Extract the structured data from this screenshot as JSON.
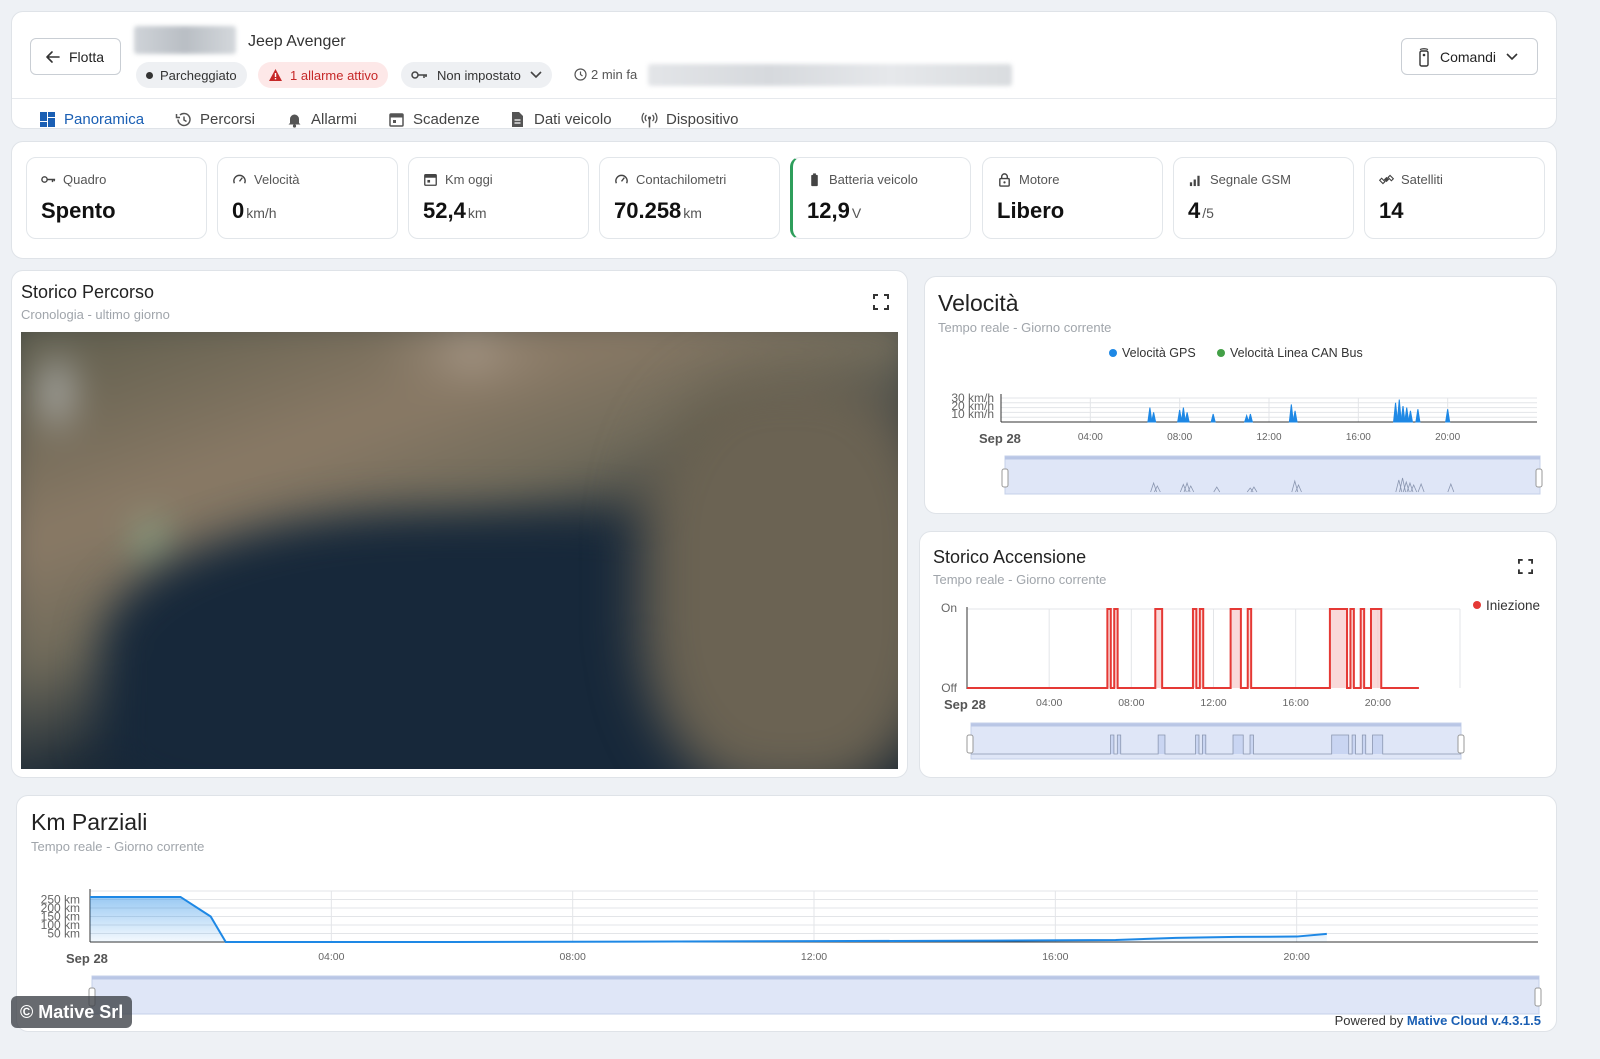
{
  "header": {
    "back_label": "Flotta",
    "vehicle_name": "Jeep Avenger",
    "status_parked": "Parcheggiato",
    "alarm_badge": "1 allarme attivo",
    "key_select": "Non impostato",
    "last_update": "2 min fa",
    "commands_label": "Comandi"
  },
  "tabs": [
    {
      "label": "Panoramica",
      "icon": "dashboard-icon",
      "active": true
    },
    {
      "label": "Percorsi",
      "icon": "history-icon"
    },
    {
      "label": "Allarmi",
      "icon": "bell-icon"
    },
    {
      "label": "Scadenze",
      "icon": "calendar-icon"
    },
    {
      "label": "Dati veicolo",
      "icon": "document-icon"
    },
    {
      "label": "Dispositivo",
      "icon": "antenna-icon"
    }
  ],
  "stats": [
    {
      "label": "Quadro",
      "value": "Spento",
      "unit": "",
      "icon": "key-icon"
    },
    {
      "label": "Velocità",
      "value": "0",
      "unit": "km/h",
      "icon": "speedometer-icon"
    },
    {
      "label": "Km oggi",
      "value": "52,4",
      "unit": "km",
      "icon": "calendar-icon"
    },
    {
      "label": "Contachilometri",
      "value": "70.258",
      "unit": "km",
      "icon": "odometer-icon"
    },
    {
      "label": "Batteria veicolo",
      "value": "12,9",
      "unit": "V",
      "icon": "battery-icon"
    },
    {
      "label": "Motore",
      "value": "Libero",
      "unit": "",
      "icon": "lock-icon"
    },
    {
      "label": "Segnale GSM",
      "value": "4",
      "unit": "/5",
      "icon": "signal-icon"
    },
    {
      "label": "Satelliti",
      "value": "14",
      "unit": "",
      "icon": "satellite-icon"
    }
  ],
  "route_panel": {
    "title": "Storico Percorso",
    "subtitle": "Cronologia - ultimo giorno"
  },
  "speed_panel": {
    "title": "Velocità",
    "subtitle": "Tempo reale - Giorno corrente"
  },
  "ignition_panel": {
    "title": "Storico Accensione",
    "subtitle": "Tempo reale - Giorno corrente"
  },
  "km_panel": {
    "title": "Km Parziali",
    "subtitle": "Tempo reale - Giorno corrente"
  },
  "footer": {
    "copyright": "© Mative Srl",
    "powered_prefix": "Powered by",
    "powered_brand": "Mative Cloud v.4.3.1.5"
  },
  "colors": {
    "accent": "#1a73e8",
    "gps": "#1e88e5",
    "can": "#43a047",
    "ignition": "#e53935",
    "alarm_bg": "#fde8e8",
    "alarm_text": "#c62828"
  },
  "chart_data": [
    {
      "type": "area",
      "title": "Velocità",
      "x_start_label": "Sep 28",
      "x_tick_labels": [
        "04:00",
        "08:00",
        "12:00",
        "16:00",
        "20:00"
      ],
      "y_tick_labels": [
        "10 km/h",
        "20 km/h",
        "30 km/h"
      ],
      "series": [
        {
          "name": "Velocità GPS",
          "color": "#1e88e5",
          "x": [
            "06:40",
            "06:50",
            "08:00",
            "08:10",
            "08:20",
            "09:30",
            "11:00",
            "11:10",
            "13:00",
            "13:10",
            "17:40",
            "17:50",
            "18:00",
            "18:10",
            "18:20",
            "18:40",
            "20:00"
          ],
          "y": [
            18,
            12,
            15,
            18,
            12,
            10,
            8,
            10,
            22,
            14,
            24,
            28,
            20,
            18,
            14,
            16,
            16
          ]
        },
        {
          "name": "Velocità Linea CAN Bus",
          "color": "#43a047",
          "x": [],
          "y": []
        }
      ],
      "legend": "top"
    },
    {
      "type": "line",
      "title": "Storico Accensione",
      "x_start_label": "Sep 28",
      "x_tick_labels": [
        "04:00",
        "08:00",
        "12:00",
        "16:00",
        "20:00"
      ],
      "y_categories": [
        "Off",
        "On"
      ],
      "series": [
        {
          "name": "Iniezione",
          "color": "#e53935",
          "intervals_on": [
            [
              "06:50",
              "07:00"
            ],
            [
              "07:10",
              "07:20"
            ],
            [
              "09:10",
              "09:30"
            ],
            [
              "11:00",
              "11:10"
            ],
            [
              "11:20",
              "11:30"
            ],
            [
              "12:50",
              "13:20"
            ],
            [
              "13:40",
              "13:50"
            ],
            [
              "17:40",
              "18:30"
            ],
            [
              "18:40",
              "18:50"
            ],
            [
              "19:10",
              "19:20"
            ],
            [
              "19:40",
              "20:10"
            ]
          ]
        }
      ],
      "legend": "right"
    },
    {
      "type": "area",
      "title": "Km Parziali",
      "x_start_label": "Sep 28",
      "x_tick_labels": [
        "04:00",
        "08:00",
        "12:00",
        "16:00",
        "20:00"
      ],
      "y_tick_labels": [
        "50 km",
        "100 km",
        "150 km",
        "200 km",
        "250 km"
      ],
      "series": [
        {
          "name": "",
          "color": "#1e88e5",
          "x": [
            "00:00",
            "01:30",
            "02:00",
            "02:15",
            "06:00",
            "09:00",
            "12:00",
            "15:00",
            "17:00",
            "18:00",
            "19:00",
            "20:00",
            "20:30"
          ],
          "y": [
            265,
            265,
            150,
            0,
            0,
            2,
            5,
            8,
            12,
            24,
            30,
            32,
            48
          ]
        }
      ]
    }
  ]
}
